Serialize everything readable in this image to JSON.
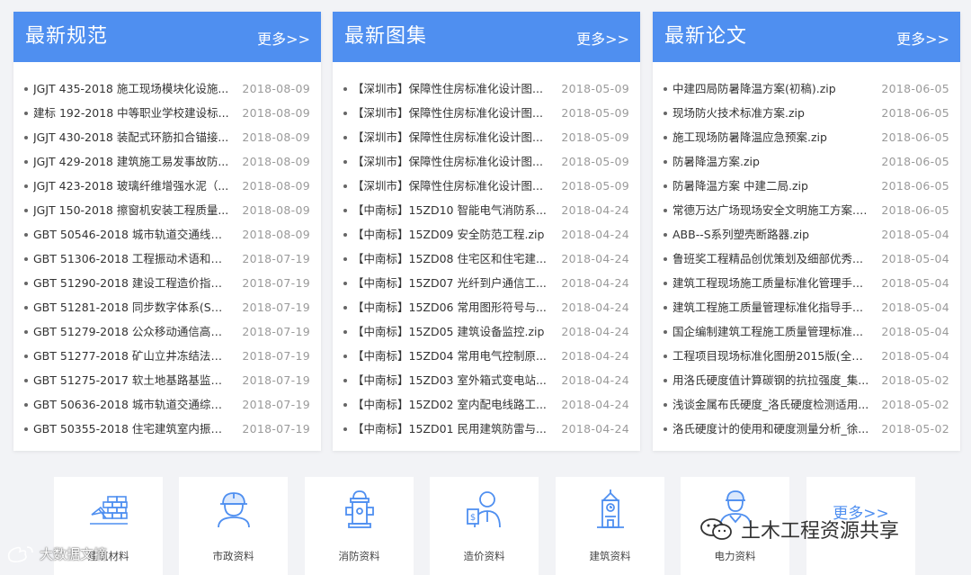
{
  "colors": {
    "accent": "#4f8ff0",
    "text": "#333333",
    "date": "#9a9a9a",
    "background": "#f2f3f6"
  },
  "panels": [
    {
      "title": "最新规范",
      "more": "更多>>",
      "items": [
        {
          "title": "JGJT 435-2018 施工现场模块化设施...",
          "date": "2018-08-09"
        },
        {
          "title": "建标 192-2018 中等职业学校建设标...",
          "date": "2018-08-09"
        },
        {
          "title": "JGJT 430-2018 装配式环筋扣合锚接...",
          "date": "2018-08-09"
        },
        {
          "title": "JGJT 429-2018 建筑施工易发事故防...",
          "date": "2018-08-09"
        },
        {
          "title": "JGJT 423-2018 玻璃纤维增强水泥（...",
          "date": "2018-08-09"
        },
        {
          "title": "JGJT 150-2018 擦窗机安装工程质量...",
          "date": "2018-08-09"
        },
        {
          "title": "GBT 50546-2018 城市轨道交通线网...",
          "date": "2018-08-09"
        },
        {
          "title": "GBT 51306-2018 工程振动术语和符...",
          "date": "2018-07-19"
        },
        {
          "title": "GBT 51290-2018 建设工程造价指标...",
          "date": "2018-07-19"
        },
        {
          "title": "GBT 51281-2018 同步数字体系(SDH...",
          "date": "2018-07-19"
        },
        {
          "title": "GBT 51279-2018 公众移动通信高速...",
          "date": "2018-07-19"
        },
        {
          "title": "GBT 51277-2018 矿山立井冻结法施...",
          "date": "2018-07-19"
        },
        {
          "title": "GBT 51275-2017 软土地基路基监控...",
          "date": "2018-07-19"
        },
        {
          "title": "GBT 50636-2018 城市轨道交通综合...",
          "date": "2018-07-19"
        },
        {
          "title": "GBT 50355-2018 住宅建筑室内振动...",
          "date": "2018-07-19"
        }
      ]
    },
    {
      "title": "最新图集",
      "more": "更多>>",
      "items": [
        {
          "title": "【深圳市】保障性住房标准化设计图...",
          "date": "2018-05-09"
        },
        {
          "title": "【深圳市】保障性住房标准化设计图...",
          "date": "2018-05-09"
        },
        {
          "title": "【深圳市】保障性住房标准化设计图...",
          "date": "2018-05-09"
        },
        {
          "title": "【深圳市】保障性住房标准化设计图...",
          "date": "2018-05-09"
        },
        {
          "title": "【深圳市】保障性住房标准化设计图...",
          "date": "2018-05-09"
        },
        {
          "title": "【中南标】15ZD10 智能电气消防系...",
          "date": "2018-04-24"
        },
        {
          "title": "【中南标】15ZD09 安全防范工程.zip",
          "date": "2018-04-24"
        },
        {
          "title": "【中南标】15ZD08 住宅区和住宅建...",
          "date": "2018-04-24"
        },
        {
          "title": "【中南标】15ZD07 光纤到户通信工...",
          "date": "2018-04-24"
        },
        {
          "title": "【中南标】15ZD06 常用图形符号与...",
          "date": "2018-04-24"
        },
        {
          "title": "【中南标】15ZD05 建筑设备监控.zip",
          "date": "2018-04-24"
        },
        {
          "title": "【中南标】15ZD04 常用电气控制原...",
          "date": "2018-04-24"
        },
        {
          "title": "【中南标】15ZD03 室外箱式变电站...",
          "date": "2018-04-24"
        },
        {
          "title": "【中南标】15ZD02 室内配电线路工...",
          "date": "2018-04-24"
        },
        {
          "title": "【中南标】15ZD01 民用建筑防雷与...",
          "date": "2018-04-24"
        }
      ]
    },
    {
      "title": "最新论文",
      "more": "更多>>",
      "items": [
        {
          "title": "中建四局防暑降温方案(初稿).zip",
          "date": "2018-06-05"
        },
        {
          "title": "现场防火技术标准方案.zip",
          "date": "2018-06-05"
        },
        {
          "title": "施工现场防暑降温应急预案.zip",
          "date": "2018-06-05"
        },
        {
          "title": "防暑降温方案.zip",
          "date": "2018-06-05"
        },
        {
          "title": "防暑降温方案 中建二局.zip",
          "date": "2018-06-05"
        },
        {
          "title": "常德万达广场现场安全文明施工方案.z...",
          "date": "2018-06-05"
        },
        {
          "title": "ABB--S系列塑壳断路器.zip",
          "date": "2018-05-04"
        },
        {
          "title": "鲁班奖工程精品创优策划及细部优秀...",
          "date": "2018-05-04"
        },
        {
          "title": "建筑工程现场施工质量标准化管理手...",
          "date": "2018-05-04"
        },
        {
          "title": "建筑工程施工质量管理标准化指导手...",
          "date": "2018-05-04"
        },
        {
          "title": "国企编制建筑工程施工质量管理标准...",
          "date": "2018-05-04"
        },
        {
          "title": "工程项目现场标准化图册2015版(全册...",
          "date": "2018-05-04"
        },
        {
          "title": "用洛氏硬度值计算碳钢的抗拉强度_集...",
          "date": "2018-05-02"
        },
        {
          "title": "浅谈金属布氏硬度_洛氏硬度检测适用...",
          "date": "2018-05-02"
        },
        {
          "title": "洛氏硬度计的使用和硬度测量分析_徐...",
          "date": "2018-05-02"
        }
      ]
    }
  ],
  "categories": [
    {
      "label": "建筑材料",
      "icon": "construction-worker-bricks-icon"
    },
    {
      "label": "市政资料",
      "icon": "hardhat-worker-icon"
    },
    {
      "label": "消防资料",
      "icon": "fire-hydrant-icon"
    },
    {
      "label": "造价资料",
      "icon": "cost-consultant-icon"
    },
    {
      "label": "建筑资料",
      "icon": "clock-tower-icon"
    },
    {
      "label": "电力资料",
      "icon": "electrician-icon"
    }
  ],
  "more_tile": "更多>>",
  "watermarks": {
    "right": "土木工程资源共享",
    "left": "大数据文摘"
  }
}
